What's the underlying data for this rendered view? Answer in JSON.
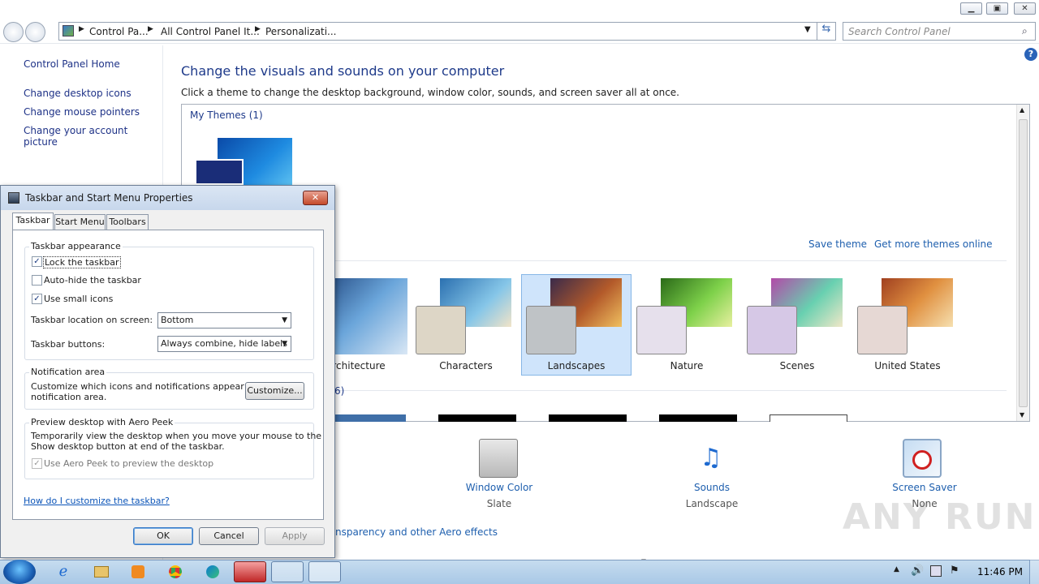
{
  "window": {
    "minimize": "▁",
    "maximize": "▣",
    "close": "✕"
  },
  "address": {
    "crumbs": [
      "Control Pa...",
      "All Control Panel It...",
      "Personalizati..."
    ],
    "search_placeholder": "Search Control Panel"
  },
  "leftpane": {
    "home": "Control Panel Home",
    "links": [
      "Change desktop icons",
      "Change mouse pointers",
      "Change your account picture"
    ]
  },
  "main": {
    "heading": "Change the visuals and sounds on your computer",
    "subheading": "Click a theme to change the desktop background, window color, sounds, and screen saver all at once.",
    "my_themes": "My Themes (1)",
    "save_theme": "Save theme",
    "get_more": "Get more themes online",
    "aero_count_partial": "6)",
    "themes": [
      "rchitecture",
      "Characters",
      "Landscapes",
      "Nature",
      "Scenes",
      "United States"
    ],
    "selected_theme": "Landscapes",
    "bottom": {
      "window_color_label": "Window Color",
      "window_color_value": "Slate",
      "sounds_label": "Sounds",
      "sounds_value": "Landscape",
      "screensaver_label": "Screen Saver",
      "screensaver_value": "None",
      "aero_link": "nsparency and other Aero effects"
    }
  },
  "dialog": {
    "title": "Taskbar and Start Menu Properties",
    "tabs": [
      "Taskbar",
      "Start Menu",
      "Toolbars"
    ],
    "appearance": {
      "title": "Taskbar appearance",
      "lock": "Lock the taskbar",
      "lock_checked": true,
      "autohide": "Auto-hide the taskbar",
      "autohide_checked": false,
      "small_icons": "Use small icons",
      "small_icons_checked": true,
      "location_label": "Taskbar location on screen:",
      "location_value": "Bottom",
      "buttons_label": "Taskbar buttons:",
      "buttons_value": "Always combine, hide labels"
    },
    "notification": {
      "title": "Notification area",
      "text1": "Customize which icons and notifications appear in the",
      "text2": "notifi​ca​tion area.",
      "customize": "Customize..."
    },
    "peek": {
      "title": "Preview desktop with Aero Peek",
      "text1": "Temporarily view the desktop when you move your mouse to the",
      "text2": "Show desktop button at end of the taskbar.",
      "check": "Use Aero Peek to preview the desktop"
    },
    "help_link": "How do I customize the taskbar?",
    "ok": "OK",
    "cancel": "Cancel",
    "apply": "Apply"
  },
  "taskbar": {
    "time": "11:46 PM"
  },
  "watermark": "ANY RUN"
}
